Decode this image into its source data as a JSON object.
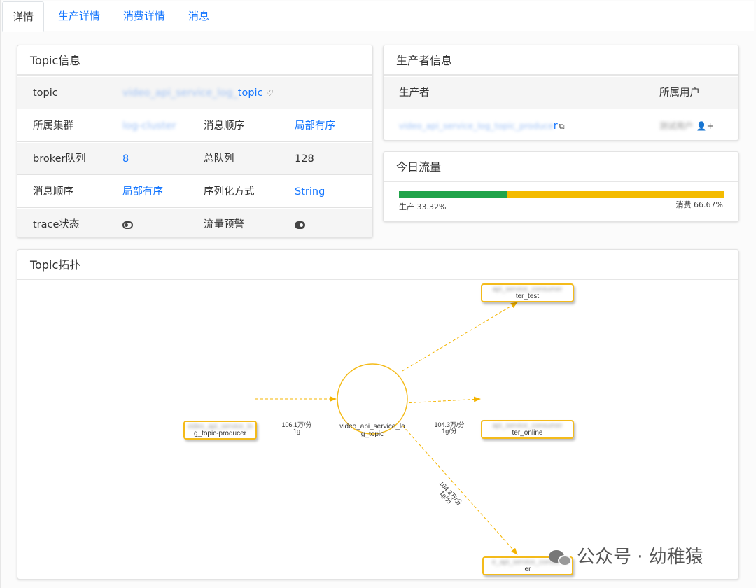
{
  "tabs": [
    {
      "label": "详情",
      "active": true
    },
    {
      "label": "生产详情",
      "active": false
    },
    {
      "label": "消费详情",
      "active": false
    },
    {
      "label": "消息",
      "active": false
    }
  ],
  "topic_info": {
    "title": "Topic信息",
    "rows": [
      {
        "label": "topic",
        "value": "video_api_service_log_topic"
      },
      {
        "label": "所属集群",
        "value": "log-cluster",
        "label2": "消息顺序",
        "value2": "局部有序"
      },
      {
        "label": "broker队列",
        "value": "8",
        "label2": "总队列",
        "value2": "128"
      },
      {
        "label": "消息顺序",
        "value": "局部有序",
        "label2": "序列化方式",
        "value2": "String"
      },
      {
        "label": "trace状态",
        "label2": "流量预警",
        "trace_on": false,
        "alert_on": true
      }
    ]
  },
  "producer_info": {
    "title": "生产者信息",
    "col_producer": "生产者",
    "col_user": "所属用户",
    "producer": "video_api_service_log_topic_producer",
    "user": "测试用户"
  },
  "traffic": {
    "title": "今日流量",
    "produce_label": "生产 33.32%",
    "consume_label": "消费 66.67%",
    "produce_pct": 33.32,
    "consume_pct": 66.67,
    "produce_color": "#20a44a",
    "consume_color": "#f4bb00"
  },
  "topology": {
    "title": "Topic拓扑",
    "center": {
      "line1": "video_api_service_lo",
      "line2": "g_topic"
    },
    "producer": {
      "line1": "video_api_service_lo",
      "line2": "g_topic-producer",
      "edge_line1": "106.1万/分",
      "edge_line2": "1g"
    },
    "consumers": [
      {
        "line1": "api_service_consumer",
        "line2": "ter_test"
      },
      {
        "line1": "api_service_consumer",
        "line2": "ter_online",
        "edge_line1": "104.3万/分",
        "edge_line2": "1g/分"
      },
      {
        "line1": "e_api_service_consum",
        "line2": "er",
        "edge_line1": "104.3万/分",
        "edge_line2": "1g/分"
      }
    ]
  },
  "watermark": "公众号 · 幼稚猿",
  "icons": {
    "heart": "heart-icon",
    "copy": "copy-icon",
    "user_add": "user-add-icon",
    "wechat": "wechat-icon"
  }
}
